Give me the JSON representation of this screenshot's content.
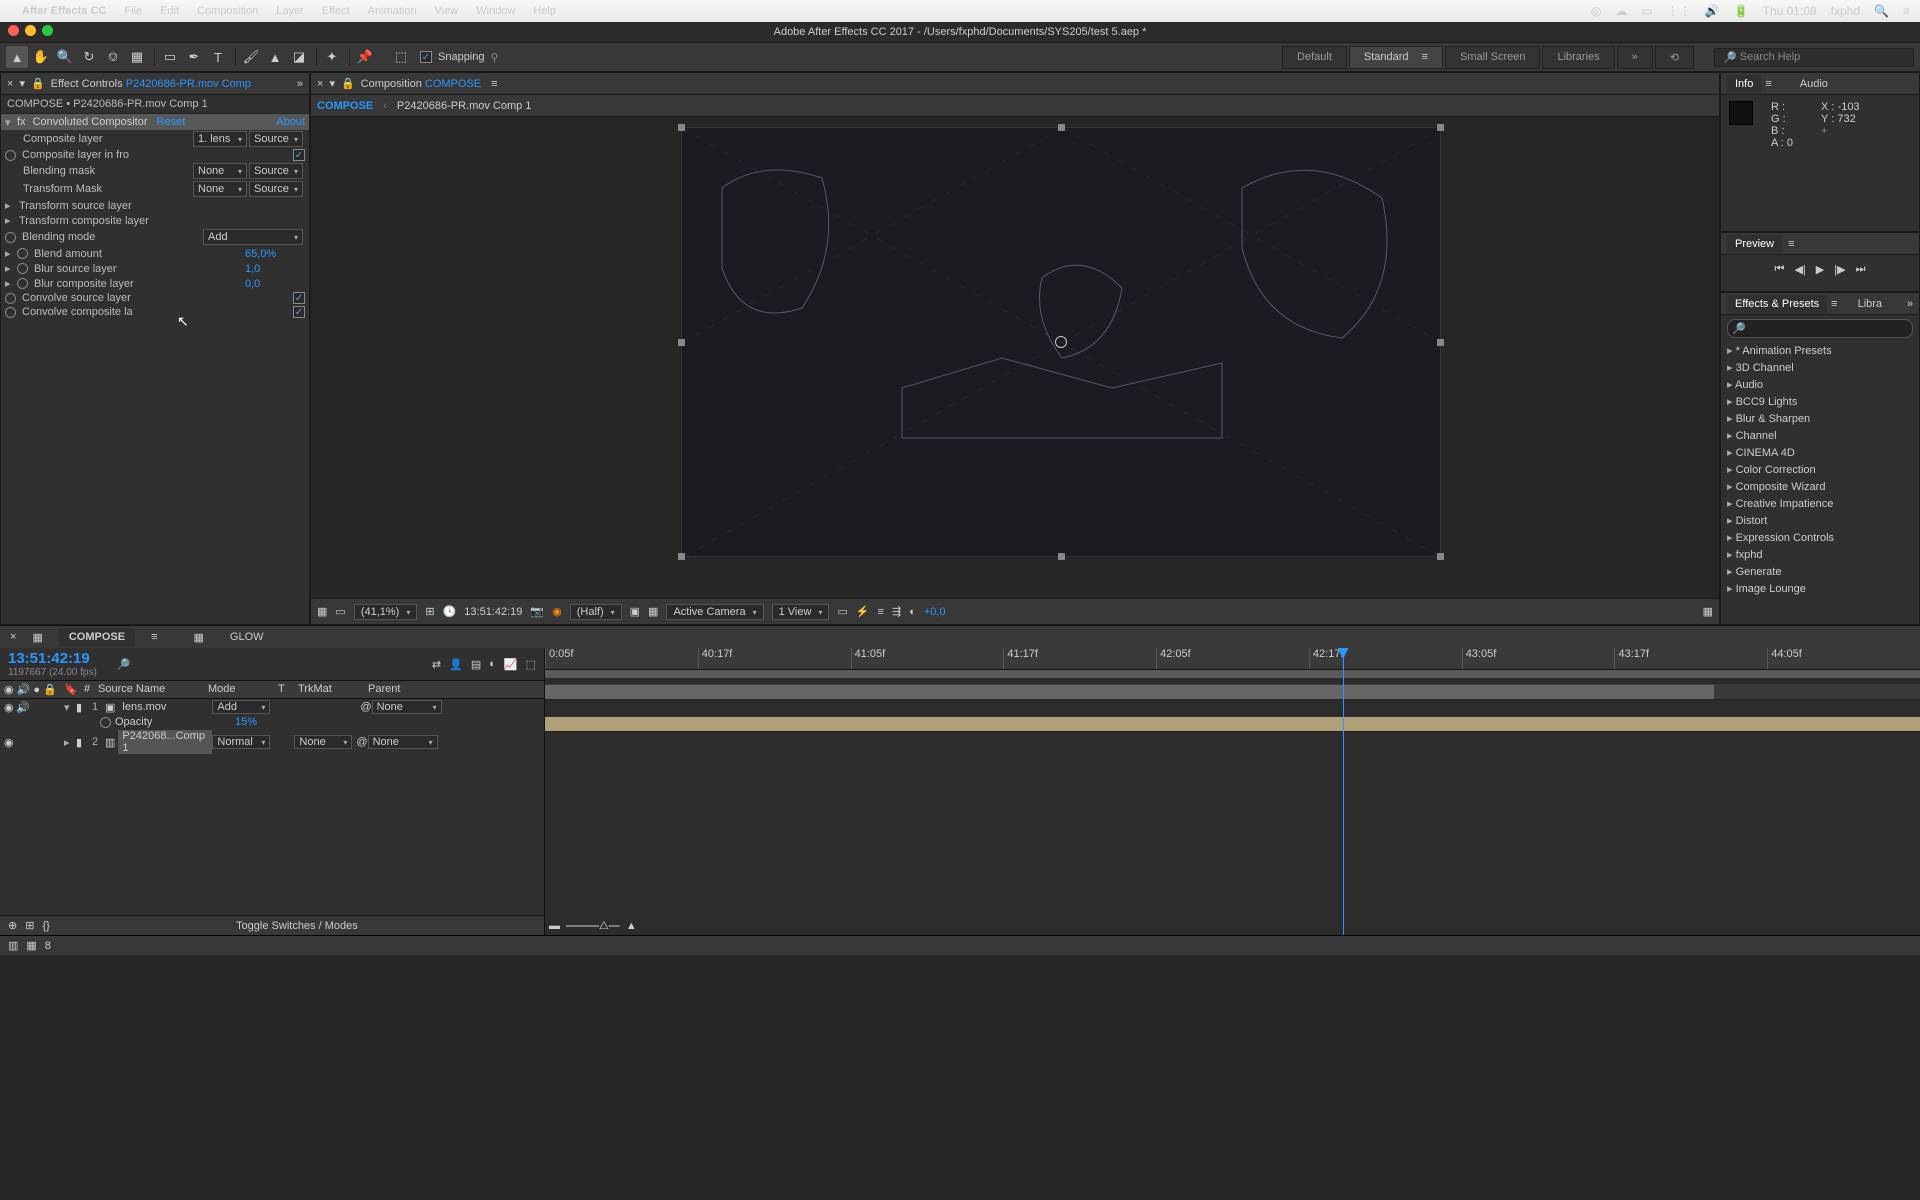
{
  "mac_menu": {
    "app": "After Effects CC",
    "items": [
      "File",
      "Edit",
      "Composition",
      "Layer",
      "Effect",
      "Animation",
      "View",
      "Window",
      "Help"
    ],
    "clock": "Thu 01:08",
    "user": "fxphd"
  },
  "title_bar": "Adobe After Effects CC 2017 - /Users/fxphd/Documents/SYS205/test 5.aep *",
  "toolbar": {
    "snapping_label": "Snapping",
    "workspaces": [
      "Default",
      "Standard",
      "Small Screen",
      "Libraries"
    ],
    "active_workspace": 1,
    "search_placeholder": "Search Help"
  },
  "fx_panel": {
    "tab_label": "Effect Controls",
    "tab_comp": "P2420686-PR.mov Comp",
    "breadcrumb": "COMPOSE • P2420686-PR.mov Comp 1",
    "effect_name": "Convoluted Compositor",
    "reset": "Reset",
    "about": "About",
    "rows": {
      "composite_layer": {
        "label": "Composite layer",
        "val_a": "1. lens",
        "val_b": "Source"
      },
      "composite_in_front": {
        "label": "Composite layer in fro",
        "checked": true
      },
      "blending_mask": {
        "label": "Blending mask",
        "val_a": "None",
        "val_b": "Source"
      },
      "transform_mask": {
        "label": "Transform Mask",
        "val_a": "None",
        "val_b": "Source"
      },
      "transform_source": {
        "label": "Transform source layer"
      },
      "transform_composite": {
        "label": "Transform composite layer"
      },
      "blending_mode": {
        "label": "Blending mode",
        "val": "Add"
      },
      "blend_amount": {
        "label": "Blend amount",
        "val": "65,0%"
      },
      "blur_source": {
        "label": "Blur source layer",
        "val": "1,0"
      },
      "blur_composite": {
        "label": "Blur composite layer",
        "val": "0,0"
      },
      "convolve_source": {
        "label": "Convolve source layer",
        "checked": true
      },
      "convolve_composite": {
        "label": "Convolve composite la",
        "checked": true
      }
    }
  },
  "comp_panel": {
    "tab_label": "Composition",
    "tab_name": "COMPOSE",
    "crumb_active": "COMPOSE",
    "crumb_next": "P2420686-PR.mov Comp 1",
    "footer": {
      "zoom": "(41,1%)",
      "timecode": "13:51:42:19",
      "res": "(Half)",
      "camera": "Active Camera",
      "view": "1 View",
      "exposure": "+0,0"
    }
  },
  "info_panel": {
    "tab_info": "Info",
    "tab_audio": "Audio",
    "r": "R :",
    "g": "G :",
    "b": "B :",
    "a": "A : 0",
    "x": "X : -103",
    "y": "Y : 732"
  },
  "preview_panel": {
    "label": "Preview"
  },
  "effects_presets": {
    "label": "Effects & Presets",
    "libra": "Libra",
    "search_placeholder": "",
    "items": [
      "* Animation Presets",
      "3D Channel",
      "Audio",
      "BCC9 Lights",
      "Blur & Sharpen",
      "Channel",
      "CINEMA 4D",
      "Color Correction",
      "Composite Wizard",
      "Creative Impatience",
      "Distort",
      "Expression Controls",
      "fxphd",
      "Generate",
      "Image Lounge"
    ]
  },
  "timeline": {
    "tabs": [
      "COMPOSE",
      "GLOW"
    ],
    "active_tab": 0,
    "timecode": "13:51:42:19",
    "fps": "1197667 (24.00 fps)",
    "columns": {
      "source": "Source Name",
      "mode": "Mode",
      "t": "T",
      "trkmat": "TrkMat",
      "parent": "Parent"
    },
    "layers": [
      {
        "num": "1",
        "name": "lens.mov",
        "mode": "Add",
        "trkmat": "",
        "parent": "None",
        "highlighted": false,
        "opacity_label": "Opacity",
        "opacity": "15%"
      },
      {
        "num": "2",
        "name": "P242068...Comp 1",
        "mode": "Normal",
        "trkmat": "None",
        "parent": "None",
        "highlighted": true
      }
    ],
    "ruler": [
      "0:05f",
      "40:17f",
      "41:05f",
      "41:17f",
      "42:05f",
      "42:17f",
      "43:05f",
      "43:17f",
      "44:05f"
    ],
    "toggle_label": "Toggle Switches / Modes"
  }
}
